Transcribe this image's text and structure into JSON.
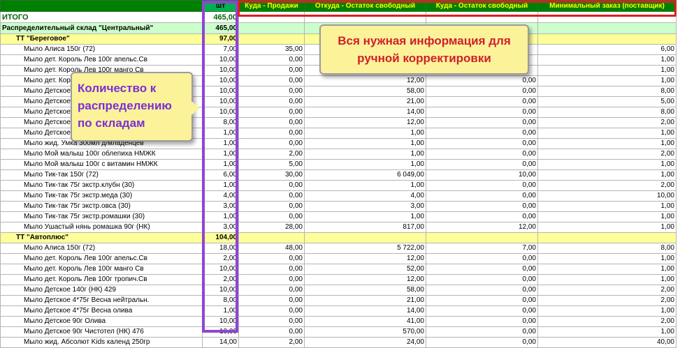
{
  "headers": {
    "name": "",
    "qty": "шт",
    "sales": "Куда - Продажи",
    "src_free": "Откуда - Остаток свободный",
    "dst_free": "Куда - Остаток свободный",
    "min_order": "Минимальный заказ (поставщик)"
  },
  "total": {
    "label": "ИТОГО",
    "qty": "465,00"
  },
  "warehouse": {
    "label": "Распределительный склад \"Центральный\"",
    "qty": "465,00"
  },
  "stores": [
    {
      "label": "ТТ  \"Береговое\"",
      "qty": "97,00",
      "items": [
        [
          "Мыло Алиса 150г (72)",
          "7,00",
          "35,00",
          "",
          "",
          "6,00"
        ],
        [
          "Мыло дет. Король Лев 100г апельс.Св",
          "10,00",
          "0,00",
          "",
          "",
          "1,00"
        ],
        [
          "Мыло дет. Король Лев 100г манго Св",
          "10,00",
          "0,00",
          "",
          "",
          "1,00"
        ],
        [
          "Мыло дет. Король Лев 100г тропич.Св",
          "10,00",
          "0,00",
          "12,00",
          "0,00",
          "1,00"
        ],
        [
          "Мыло Детское 140г (НК) 429",
          "10,00",
          "0,00",
          "58,00",
          "0,00",
          "8,00"
        ],
        [
          "Мыло Детское 4*75г Весна нейтральн.",
          "10,00",
          "0,00",
          "21,00",
          "0,00",
          "5,00"
        ],
        [
          "Мыло Детское 4*75г Весна олива",
          "10,00",
          "0,00",
          "14,00",
          "0,00",
          "8,00"
        ],
        [
          "Мыло Детское 90г Олива",
          "8,00",
          "0,00",
          "12,00",
          "0,00",
          "2,00"
        ],
        [
          "Мыло Детское 90г Чистотел (НК) 476",
          "1,00",
          "0,00",
          "1,00",
          "0,00",
          "1,00"
        ],
        [
          "Мыло жид. Умка 300мл д/младенцев",
          "1,00",
          "0,00",
          "1,00",
          "0,00",
          "1,00"
        ],
        [
          "Мыло Мой малыш 100г облепиха НМЖК",
          "1,00",
          "2,00",
          "1,00",
          "0,00",
          "2,00"
        ],
        [
          "Мыло Мой малыш 100г с витамин НМЖК",
          "1,00",
          "5,00",
          "1,00",
          "0,00",
          "1,00"
        ],
        [
          "Мыло Тик-так 150г (72)",
          "6,00",
          "30,00",
          "6 049,00",
          "10,00",
          "1,00"
        ],
        [
          "Мыло Тик-так 75г экстр.клубн (30)",
          "1,00",
          "0,00",
          "1,00",
          "0,00",
          "2,00"
        ],
        [
          "Мыло Тик-так 75г экстр.меда (30)",
          "4,00",
          "0,00",
          "4,00",
          "0,00",
          "10,00"
        ],
        [
          "Мыло Тик-так 75г экстр.овса (30)",
          "3,00",
          "0,00",
          "3,00",
          "0,00",
          "1,00"
        ],
        [
          "Мыло Тик-так 75г экстр.ромашки (30)",
          "1,00",
          "0,00",
          "1,00",
          "0,00",
          "1,00"
        ],
        [
          "Мыло Ушастый нянь ромашка 90г (НК)",
          "3,00",
          "28,00",
          "817,00",
          "12,00",
          "1,00"
        ]
      ]
    },
    {
      "label": "ТТ  \"Автоплюс\"",
      "qty": "104,00",
      "items": [
        [
          "Мыло Алиса 150г (72)",
          "18,00",
          "48,00",
          "5 722,00",
          "7,00",
          "8,00"
        ],
        [
          "Мыло дет. Король Лев 100г апельс.Св",
          "2,00",
          "0,00",
          "12,00",
          "0,00",
          "1,00"
        ],
        [
          "Мыло дет. Король Лев 100г манго Св",
          "10,00",
          "0,00",
          "52,00",
          "0,00",
          "1,00"
        ],
        [
          "Мыло дет. Король Лев 100г тропич.Св",
          "2,00",
          "0,00",
          "12,00",
          "0,00",
          "1,00"
        ],
        [
          "Мыло Детское 140г (НК) 429",
          "10,00",
          "0,00",
          "58,00",
          "0,00",
          "2,00"
        ],
        [
          "Мыло Детское 4*75г Весна нейтральн.",
          "8,00",
          "0,00",
          "21,00",
          "0,00",
          "2,00"
        ],
        [
          "Мыло Детское 4*75г Весна олива",
          "1,00",
          "0,00",
          "14,00",
          "0,00",
          "1,00"
        ],
        [
          "Мыло Детское 90г Олива",
          "10,00",
          "0,00",
          "41,00",
          "0,00",
          "2,00"
        ],
        [
          "Мыло Детское 90г Чистотел (НК) 476",
          "10,00",
          "0,00",
          "570,00",
          "0,00",
          "1,00"
        ],
        [
          "Мыло жид. Абсолют Kids календ 250гр",
          "14,00",
          "2,00",
          "24,00",
          "0,00",
          "40,00"
        ]
      ]
    }
  ],
  "callouts": {
    "info_line1": "Вся нужная информация для",
    "info_line2": "ручной корректировки",
    "qty_line1": "Количество к",
    "qty_line2": "распределению",
    "qty_line3": "по складам"
  },
  "colors": {
    "header_bg": "#008000",
    "header_text": "#ffff00",
    "warehouse_bg": "#ccffcc",
    "store_bg": "#ffff99",
    "total_text": "#006400",
    "purple_frame": "#8f45d6",
    "red_frame": "#e01d1d",
    "callout_bg": "#fbf29a"
  }
}
